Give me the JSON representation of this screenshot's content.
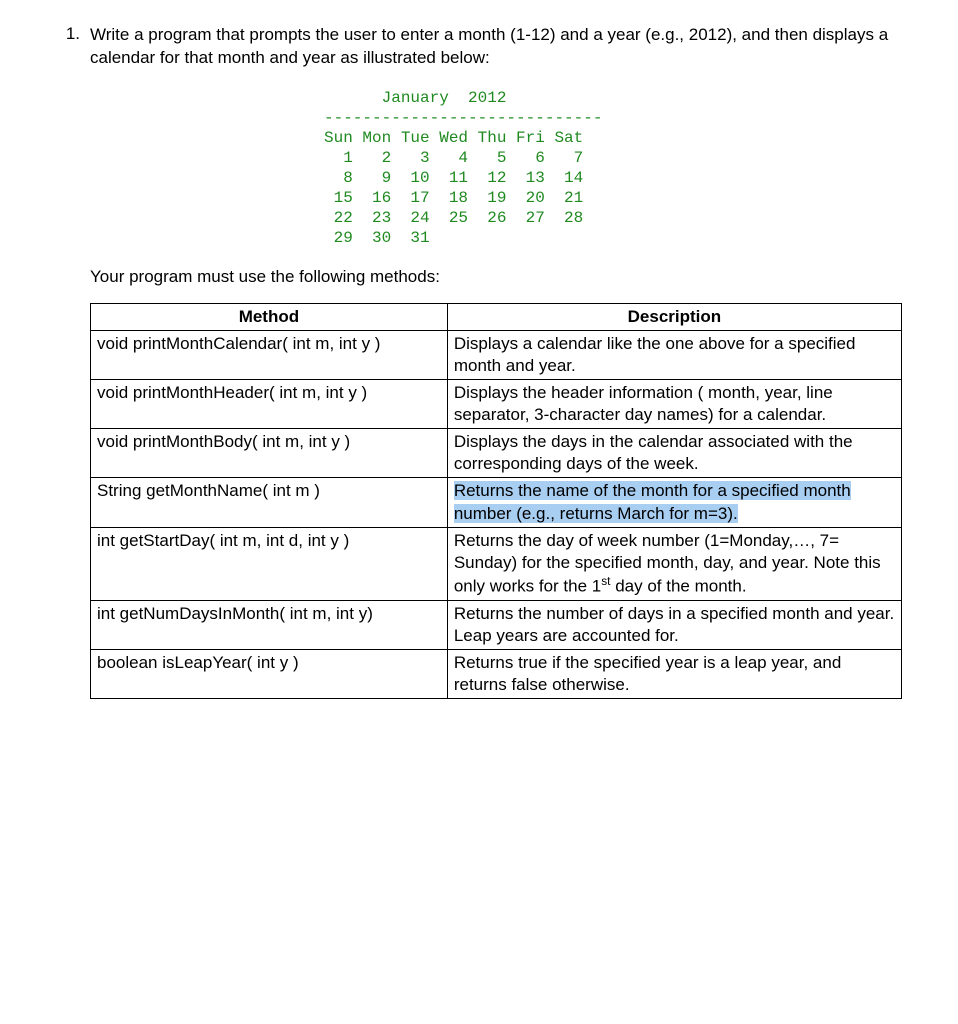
{
  "problem": {
    "number": "1.",
    "text": "Write a program that prompts the user to enter a month (1-12) and a year (e.g., 2012), and then displays a calendar for that month and year as illustrated below:"
  },
  "calendar": {
    "title": "January  2012",
    "rule": "-----------------------------",
    "header": "Sun Mon Tue Wed Thu Fri Sat",
    "rows": [
      "  1   2   3   4   5   6   7",
      "  8   9  10  11  12  13  14",
      " 15  16  17  18  19  20  21",
      " 22  23  24  25  26  27  28",
      " 29  30  31"
    ]
  },
  "sub_text": "Your program must use the following methods:",
  "table": {
    "headers": {
      "method": "Method",
      "description": "Description"
    },
    "rows": [
      {
        "method": "void printMonthCalendar( int m, int y )",
        "description": "Displays a calendar like the one above for a specified month and year."
      },
      {
        "method": "void printMonthHeader( int m, int y )",
        "description": "Displays the header information ( month, year, line separator, 3-character day names) for a calendar."
      },
      {
        "method": "void printMonthBody( int m, int y )",
        "description": "Displays the days in the calendar associated with the corresponding days of the week."
      },
      {
        "method": "String getMonthName( int m )",
        "description_highlighted": "Returns the name of the month for a specified month number (e.g., returns March for m=3)."
      },
      {
        "method": "int getStartDay( int m, int d, int y )",
        "description_html": "Returns the day of week  number (1=Monday,…, 7= Sunday) for the specified month, day, and year. Note this only works for the 1<sup>st</sup> day of the month."
      },
      {
        "method": "int getNumDaysInMonth( int m, int y)",
        "description": "Returns the number of days in a specified month and year. Leap years are accounted for."
      },
      {
        "method": "boolean isLeapYear( int y )",
        "description": "Returns true if the specified year is a leap year, and returns false otherwise."
      }
    ]
  }
}
